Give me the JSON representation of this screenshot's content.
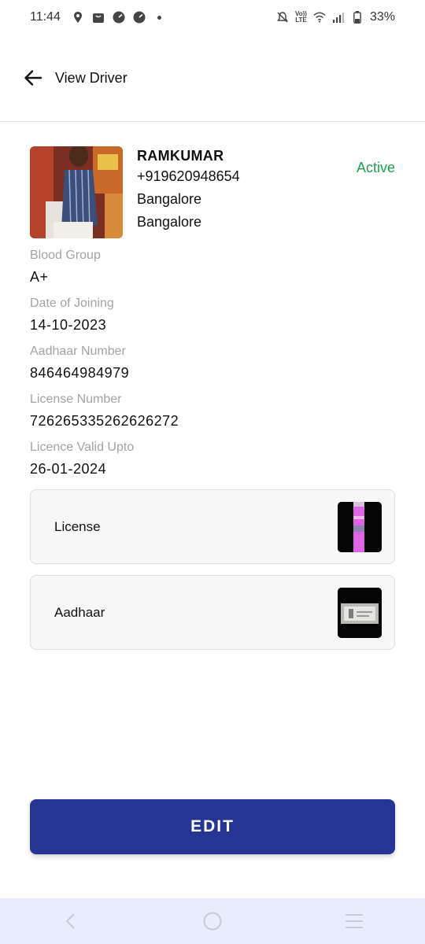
{
  "status_bar": {
    "time": "11:44",
    "battery": "33%",
    "net_label_top": "Vo))",
    "net_label_bottom": "LTE"
  },
  "header": {
    "title": "View Driver"
  },
  "driver": {
    "name": "RAMKUMAR",
    "phone": "+919620948654",
    "city": "Bangalore",
    "state": "Bangalore",
    "status": "Active"
  },
  "fields": {
    "blood_group": {
      "label": "Blood Group",
      "value": "A+"
    },
    "date_of_joining": {
      "label": "Date of Joining",
      "value": "14-10-2023"
    },
    "aadhaar_number": {
      "label": "Aadhaar Number",
      "value": "846464984979"
    },
    "license_number": {
      "label": "License Number",
      "value": "726265335262626272"
    },
    "licence_valid_upto": {
      "label": "Licence Valid Upto",
      "value": "26-01-2024"
    }
  },
  "documents": [
    {
      "label": "License"
    },
    {
      "label": "Aadhaar"
    }
  ],
  "actions": {
    "edit_label": "EDIT"
  },
  "colors": {
    "primary": "#263594",
    "active": "#1aa14a",
    "label_gray": "#a3a3a3",
    "nav_bg": "#e9ecfa"
  }
}
